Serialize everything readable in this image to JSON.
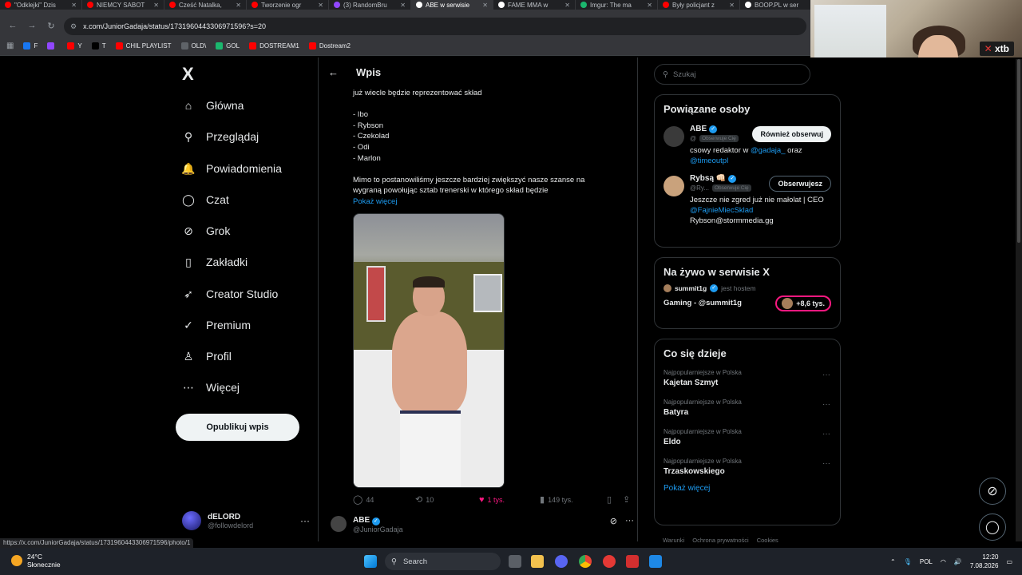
{
  "browser": {
    "tabs": [
      {
        "label": "\"Odklejki\" Dzis",
        "color": "#ff0000"
      },
      {
        "label": "NIEMCY SABOT",
        "color": "#ff0000"
      },
      {
        "label": "Cześć Natalka,",
        "color": "#ff0000"
      },
      {
        "label": "Tworzenie ogr",
        "color": "#ff0000"
      },
      {
        "label": "(3) RandomBru",
        "color": "#9147ff"
      },
      {
        "label": "ABE w serwisie",
        "color": "#ffffff"
      },
      {
        "label": "FAME MMA w",
        "color": "#ffffff"
      },
      {
        "label": "Imgur: The ma",
        "color": "#1bb76e"
      },
      {
        "label": "Były policjant z",
        "color": "#ff0000"
      },
      {
        "label": "BOOP.PL w ser",
        "color": "#ffffff"
      }
    ],
    "url": "x.com/JuniorGadaja/status/1731960443306971596?s=20",
    "bookmarks": [
      {
        "label": "F",
        "color": "#1877f2"
      },
      {
        "label": "",
        "color": "#9147ff"
      },
      {
        "label": "Y",
        "color": "#ff0000"
      },
      {
        "label": "T",
        "color": "#000000"
      },
      {
        "label": "CHIL PLAYLIST",
        "color": "#ff0000"
      },
      {
        "label": "OLD\\",
        "color": "#5f6368"
      },
      {
        "label": "GOL",
        "color": "#1bb76e"
      },
      {
        "label": "DOSTREAM1",
        "color": "#ff0000"
      },
      {
        "label": "Dostream2",
        "color": "#ff0000"
      }
    ],
    "status_url": "https://x.com/JuniorGadaja/status/1731960443306971596/photo/1"
  },
  "webcam": {
    "brand": "xtb"
  },
  "nav": {
    "logo": "X",
    "items": [
      {
        "label": "Główna",
        "icon": "home-icon",
        "glyph": "⌂"
      },
      {
        "label": "Przeglądaj",
        "icon": "search-icon",
        "glyph": "⚲"
      },
      {
        "label": "Powiadomienia",
        "icon": "bell-icon",
        "glyph": "🔔"
      },
      {
        "label": "Czat",
        "icon": "chat-icon",
        "glyph": "◯"
      },
      {
        "label": "Grok",
        "icon": "grok-icon",
        "glyph": "⊘"
      },
      {
        "label": "Zakładki",
        "icon": "bookmark-icon",
        "glyph": "▯"
      },
      {
        "label": "Creator Studio",
        "icon": "rocket-icon",
        "glyph": "➶"
      },
      {
        "label": "Premium",
        "icon": "premium-icon",
        "glyph": "✓"
      },
      {
        "label": "Profil",
        "icon": "profile-icon",
        "glyph": "♙"
      },
      {
        "label": "Więcej",
        "icon": "more-icon",
        "glyph": "⋯"
      }
    ],
    "publish": "Opublikuj wpis",
    "user": {
      "name": "dELORD",
      "handle": "@followdelord"
    }
  },
  "main": {
    "title": "Wpis",
    "text_lines": [
      "już wiecle będzie reprezentować skład",
      "",
      "- Ibo",
      "- Rybson",
      "- Czekolad",
      "- Odi",
      "- Marlon",
      "",
      "Mimo to postanowiliśmy jeszcze bardziej zwiększyć nasze szanse na",
      "wygraną powołując sztab trenerski w którego skład będzie"
    ],
    "show_more": "Pokaż więcej",
    "stats": {
      "replies": "44",
      "reposts": "10",
      "likes": "1 tys.",
      "views": "149 tys."
    },
    "reply": {
      "name": "ABE",
      "handle": "@JuniorGadaja"
    }
  },
  "right": {
    "search_placeholder": "Szukaj",
    "related_title": "Powiązane osoby",
    "people": [
      {
        "name": "ABE",
        "handle": "@",
        "follows_you": "Obserwuje Cię",
        "button": "Również obserwuj",
        "bio_a": "csowy redaktor w ",
        "bio_link1": "@gadaja_",
        "bio_b": " oraz",
        "bio_link2": "@timeoutpl",
        "avatar_color": "#3a3a3a"
      },
      {
        "name": "Rybsą 👊🏻",
        "handle": "@Ry...",
        "follows_you": "Obserwuje Cię",
        "button": "Obserwujesz",
        "bio_line1": "Jeszcze nie zgred już nie małolat | CEO",
        "bio_link": "@FajnieMiecSklad",
        "bio_line3": "Rybson@stormmedia.gg",
        "avatar_color": "#c9a27c"
      }
    ],
    "live_title": "Na żywo w serwisie X",
    "live": {
      "host": "summit1g",
      "host_suffix": "jest hostem",
      "title": "Gaming - @summit1g",
      "count": "+8,6 tys."
    },
    "trends_title": "Co się dzieje",
    "trends": [
      {
        "context": "Najpopularniejsze w Polska",
        "name": "Kajetan Szmyt"
      },
      {
        "context": "Najpopularniejsze w Polska",
        "name": "Batyra"
      },
      {
        "context": "Najpopularniejsze w Polska",
        "name": "Eldo"
      },
      {
        "context": "Najpopularniejsze w Polska",
        "name": "Trzaskowskiego"
      }
    ],
    "show_more": "Pokaż więcej",
    "footer": [
      "Warunki",
      "Ochrona prywatności",
      "Cookies"
    ]
  },
  "taskbar": {
    "weather_temp": "24°C",
    "weather_desc": "Słonecznie",
    "search": "Search",
    "lang": "POL",
    "time": "12:20",
    "date": "7.08.2026"
  }
}
